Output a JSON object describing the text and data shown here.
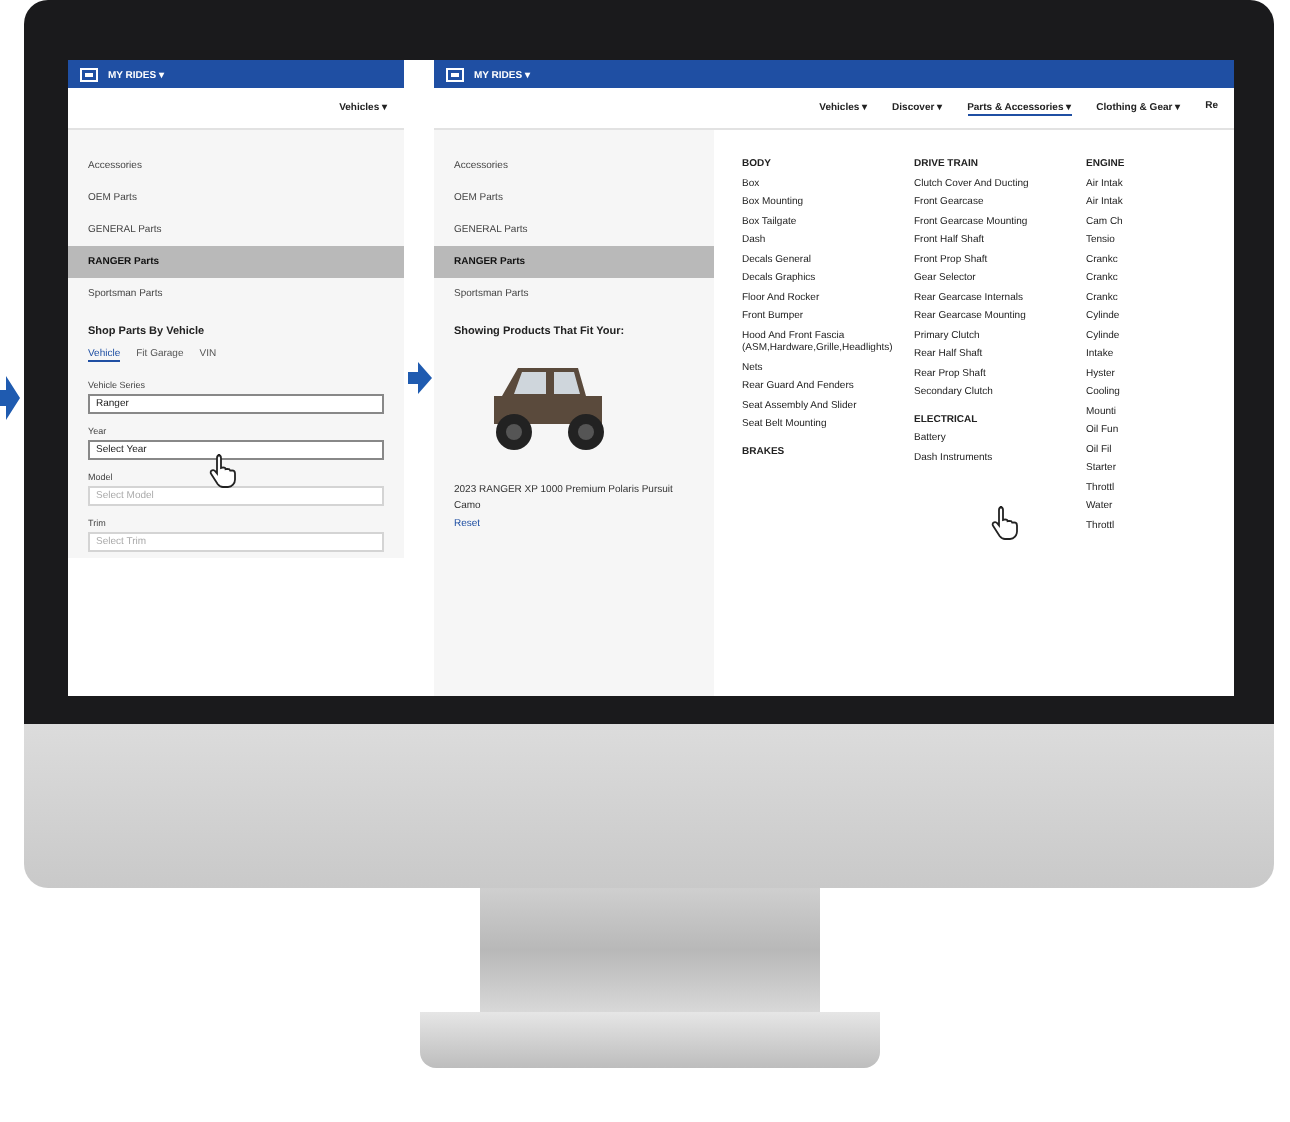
{
  "screen_1": {
    "header": {
      "menu": "MY RIDES ▾"
    },
    "nav": [
      {
        "label": "Vehicles ▾",
        "selected": false
      }
    ],
    "sidebar": [
      {
        "label": "Accessories",
        "selected": false
      },
      {
        "label": "OEM Parts",
        "selected": false
      },
      {
        "label": "GENERAL Parts",
        "selected": false
      },
      {
        "label": "RANGER Parts",
        "selected": true
      },
      {
        "label": "Sportsman Parts",
        "selected": false
      }
    ],
    "shop_title": "Shop Parts By Vehicle",
    "shop_tabs": [
      {
        "label": "Vehicle",
        "selected": true
      },
      {
        "label": "Fit Garage",
        "selected": false
      },
      {
        "label": "VIN",
        "selected": false
      }
    ],
    "fields": [
      {
        "label": "Vehicle Series",
        "value": "Ranger",
        "disabled": false
      },
      {
        "label": "Year",
        "value": "Select Year",
        "disabled": false
      },
      {
        "label": "Model",
        "placeholder": "Select Model",
        "disabled": true
      },
      {
        "label": "Trim",
        "placeholder": "Select Trim",
        "disabled": true
      }
    ]
  },
  "screen_2": {
    "header": {
      "menu": "MY RIDES ▾"
    },
    "nav": [
      {
        "label": "Vehicles ▾",
        "selected": false
      },
      {
        "label": "Discover ▾",
        "selected": false
      },
      {
        "label": "Parts & Accessories ▾",
        "selected": true
      },
      {
        "label": "Clothing & Gear ▾",
        "selected": false
      },
      {
        "label": "Re",
        "selected": false
      }
    ],
    "sidebar": [
      {
        "label": "Accessories",
        "selected": false
      },
      {
        "label": "OEM Parts",
        "selected": false
      },
      {
        "label": "GENERAL Parts",
        "selected": false
      },
      {
        "label": "RANGER Parts",
        "selected": true
      },
      {
        "label": "Sportsman Parts",
        "selected": false
      }
    ],
    "fit_title": "Showing Products That Fit Your:",
    "vehicle_name": "2023 RANGER XP 1000 Premium Polaris Pursuit Camo",
    "reset": "Reset",
    "menu_columns": [
      {
        "items": [
          {
            "label": "BODY",
            "kind": "heading"
          },
          {
            "label": "Box",
            "kind": "link"
          },
          {
            "label": "Box Mounting",
            "kind": "link"
          },
          {
            "label": "Box Tailgate",
            "kind": "link"
          },
          {
            "label": "Dash",
            "kind": "link"
          },
          {
            "label": "Decals General",
            "kind": "link"
          },
          {
            "label": "Decals Graphics",
            "kind": "link"
          },
          {
            "label": "Floor And Rocker",
            "kind": "link"
          },
          {
            "label": "Front Bumper",
            "kind": "link"
          },
          {
            "label": "Hood And Front Fascia (ASM,Hardware,Grille,Headlights)",
            "kind": "link"
          },
          {
            "label": "Nets",
            "kind": "link"
          },
          {
            "label": "Rear Guard And Fenders",
            "kind": "link"
          },
          {
            "label": "Seat Assembly And Slider",
            "kind": "link"
          },
          {
            "label": "Seat Belt Mounting",
            "kind": "link"
          },
          {
            "label": "BRAKES",
            "kind": "heading"
          }
        ]
      },
      {
        "items": [
          {
            "label": "DRIVE TRAIN",
            "kind": "heading"
          },
          {
            "label": "Clutch Cover And Ducting",
            "kind": "link"
          },
          {
            "label": "Front Gearcase",
            "kind": "link"
          },
          {
            "label": "Front Gearcase Mounting",
            "kind": "link"
          },
          {
            "label": "Front Half Shaft",
            "kind": "link"
          },
          {
            "label": "Front Prop Shaft",
            "kind": "link"
          },
          {
            "label": "Gear Selector",
            "kind": "link"
          },
          {
            "label": "Rear Gearcase Internals",
            "kind": "link"
          },
          {
            "label": "Rear Gearcase Mounting",
            "kind": "link"
          },
          {
            "label": "Primary Clutch",
            "kind": "link"
          },
          {
            "label": "Rear Half Shaft",
            "kind": "link"
          },
          {
            "label": "Rear Prop Shaft",
            "kind": "link"
          },
          {
            "label": "Secondary Clutch",
            "kind": "link"
          },
          {
            "label": "ELECTRICAL",
            "kind": "heading"
          },
          {
            "label": "Battery",
            "kind": "link"
          },
          {
            "label": "Dash Instruments",
            "kind": "link"
          }
        ]
      },
      {
        "items": [
          {
            "label": "ENGINE",
            "kind": "heading"
          },
          {
            "label": "Air Intak",
            "kind": "link"
          },
          {
            "label": "Air Intak",
            "kind": "link"
          },
          {
            "label": "Cam Ch",
            "kind": "link"
          },
          {
            "label": "Tensio",
            "kind": "link"
          },
          {
            "label": "Crankc",
            "kind": "link"
          },
          {
            "label": "Crankc",
            "kind": "link"
          },
          {
            "label": "Crankc",
            "kind": "link"
          },
          {
            "label": "Cylinde",
            "kind": "link"
          },
          {
            "label": "Cylinde",
            "kind": "link"
          },
          {
            "label": "Intake",
            "kind": "link"
          },
          {
            "label": "Hyster",
            "kind": "link"
          },
          {
            "label": "Cooling",
            "kind": "link"
          },
          {
            "label": "Mounti",
            "kind": "link"
          },
          {
            "label": "Oil Fun",
            "kind": "link"
          },
          {
            "label": "Oil Fil",
            "kind": "link"
          },
          {
            "label": "Starter",
            "kind": "link"
          },
          {
            "label": "Throttl",
            "kind": "link"
          },
          {
            "label": "Water",
            "kind": "link"
          },
          {
            "label": "Throttl",
            "kind": "link"
          }
        ]
      }
    ]
  }
}
